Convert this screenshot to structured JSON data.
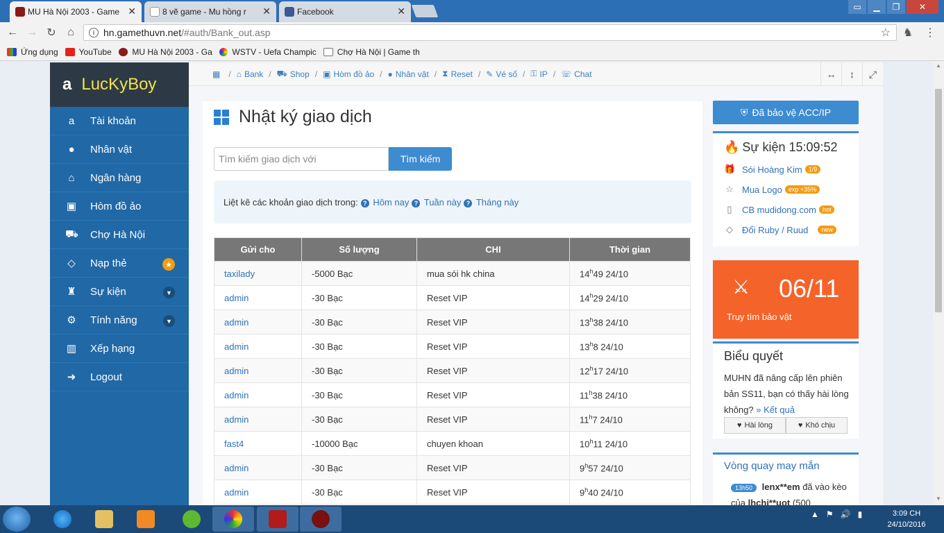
{
  "browser": {
    "tabs": [
      {
        "title": "MU Hà Nội 2003 - Game",
        "active": true
      },
      {
        "title": "8 vẽ game - Mu hồng r",
        "active": false
      },
      {
        "title": "Facebook",
        "active": false
      }
    ],
    "close_glyph": "✕",
    "url_host": "hn.gamethuvn.net",
    "url_path": "/#auth/Bank_out.asp",
    "bookmarks": [
      "Ứng dụng",
      "YouTube",
      "MU Hà Nội 2003 - Ga",
      "WSTV - Uefa Champic",
      "Chợ Hà Nội | Game th"
    ]
  },
  "sidebar": {
    "brand": "LucKyBoy",
    "items": [
      {
        "label": "Tài khoản",
        "icon": "amazon-icon"
      },
      {
        "label": "Nhân vật",
        "icon": "user-icon"
      },
      {
        "label": "Ngân hàng",
        "icon": "bank-icon"
      },
      {
        "label": "Hòm đồ ảo",
        "icon": "briefcase-icon"
      },
      {
        "label": "Chợ Hà Nội",
        "icon": "cart-icon"
      },
      {
        "label": "Nạp thẻ",
        "icon": "diamond-icon"
      },
      {
        "label": "Sự kiện",
        "icon": "android-icon"
      },
      {
        "label": "Tính năng",
        "icon": "gears-icon"
      },
      {
        "label": "Xếp hạng",
        "icon": "chart-icon"
      },
      {
        "label": "Logout",
        "icon": "logout-icon"
      }
    ]
  },
  "breadcrumbs": [
    "Bank",
    "Shop",
    "Hòm đồ ảo",
    "Nhân vật",
    "Reset",
    "Vé số",
    "IP",
    "Chat"
  ],
  "main": {
    "title": "Nhật ký giao dịch",
    "search_placeholder": "Tìm kiếm giao dịch với",
    "search_button": "Tìm kiếm",
    "info_text": "Liệt kê các khoản giao dịch trong:",
    "info_links": [
      "Hôm nay",
      "Tuần này",
      "Tháng này"
    ],
    "columns": [
      "Gửi cho",
      "Số lượng",
      "CHI",
      "Thời gian"
    ],
    "rows": [
      {
        "to": "taxilady",
        "amount": "-5000  Bạc",
        "note": "mua sói hk china",
        "h": "14",
        "rest": "49 24/10"
      },
      {
        "to": "admin",
        "amount": "-30  Bạc",
        "note": "Reset VIP",
        "h": "14",
        "rest": "29 24/10"
      },
      {
        "to": "admin",
        "amount": "-30  Bạc",
        "note": "Reset VIP",
        "h": "13",
        "rest": "38 24/10"
      },
      {
        "to": "admin",
        "amount": "-30  Bạc",
        "note": "Reset VIP",
        "h": "13",
        "rest": "8 24/10"
      },
      {
        "to": "admin",
        "amount": "-30  Bạc",
        "note": "Reset VIP",
        "h": "12",
        "rest": "17 24/10"
      },
      {
        "to": "admin",
        "amount": "-30  Bạc",
        "note": "Reset VIP",
        "h": "11",
        "rest": "38 24/10"
      },
      {
        "to": "admin",
        "amount": "-30  Bạc",
        "note": "Reset VIP",
        "h": "11",
        "rest": "7 24/10"
      },
      {
        "to": "fast4",
        "amount": "-10000  Bạc",
        "note": "chuyen khoan",
        "h": "10",
        "rest": "11 24/10"
      },
      {
        "to": "admin",
        "amount": "-30  Bạc",
        "note": "Reset VIP",
        "h": "9",
        "rest": "57 24/10"
      },
      {
        "to": "admin",
        "amount": "-30  Bạc",
        "note": "Reset VIP",
        "h": "9",
        "rest": "40 24/10"
      }
    ]
  },
  "right": {
    "protect_button": "Đã bảo vệ ACC/IP",
    "event_title": "Sự kiện 15:09:52",
    "events": [
      {
        "label": "Sói Hoàng Kim",
        "tag": "1/9",
        "icon": "gift-icon"
      },
      {
        "label": "Mua Logo",
        "tag": "exp +35%",
        "icon": "star-icon"
      },
      {
        "label": "CB mudidong.com",
        "tag": "hot",
        "icon": "mobile-icon"
      },
      {
        "label": "Đổi Ruby / Ruud",
        "tag": "new",
        "icon": "diamond-icon"
      }
    ],
    "promo_date": "06/11",
    "promo_sub": "Truy tìm bảo vật",
    "poll_title": "Biểu quyết",
    "poll_question": "MUHN đã nâng cấp lên phiên bản SS11, bạn có thấy hài lòng không?",
    "poll_result": "» Kết quả",
    "vote_yes": "Hài lòng",
    "vote_no": "Khó chịu",
    "wheel_title": "Vòng quay may mắn",
    "wheel_time": "13h50",
    "wheel_user": "lenx**em",
    "wheel_text": "đã vào kèo của",
    "wheel_target": "lhchi**uot",
    "wheel_tail": "(500"
  },
  "taskbar": {
    "time": "3:09 CH",
    "date": "24/10/2016"
  }
}
